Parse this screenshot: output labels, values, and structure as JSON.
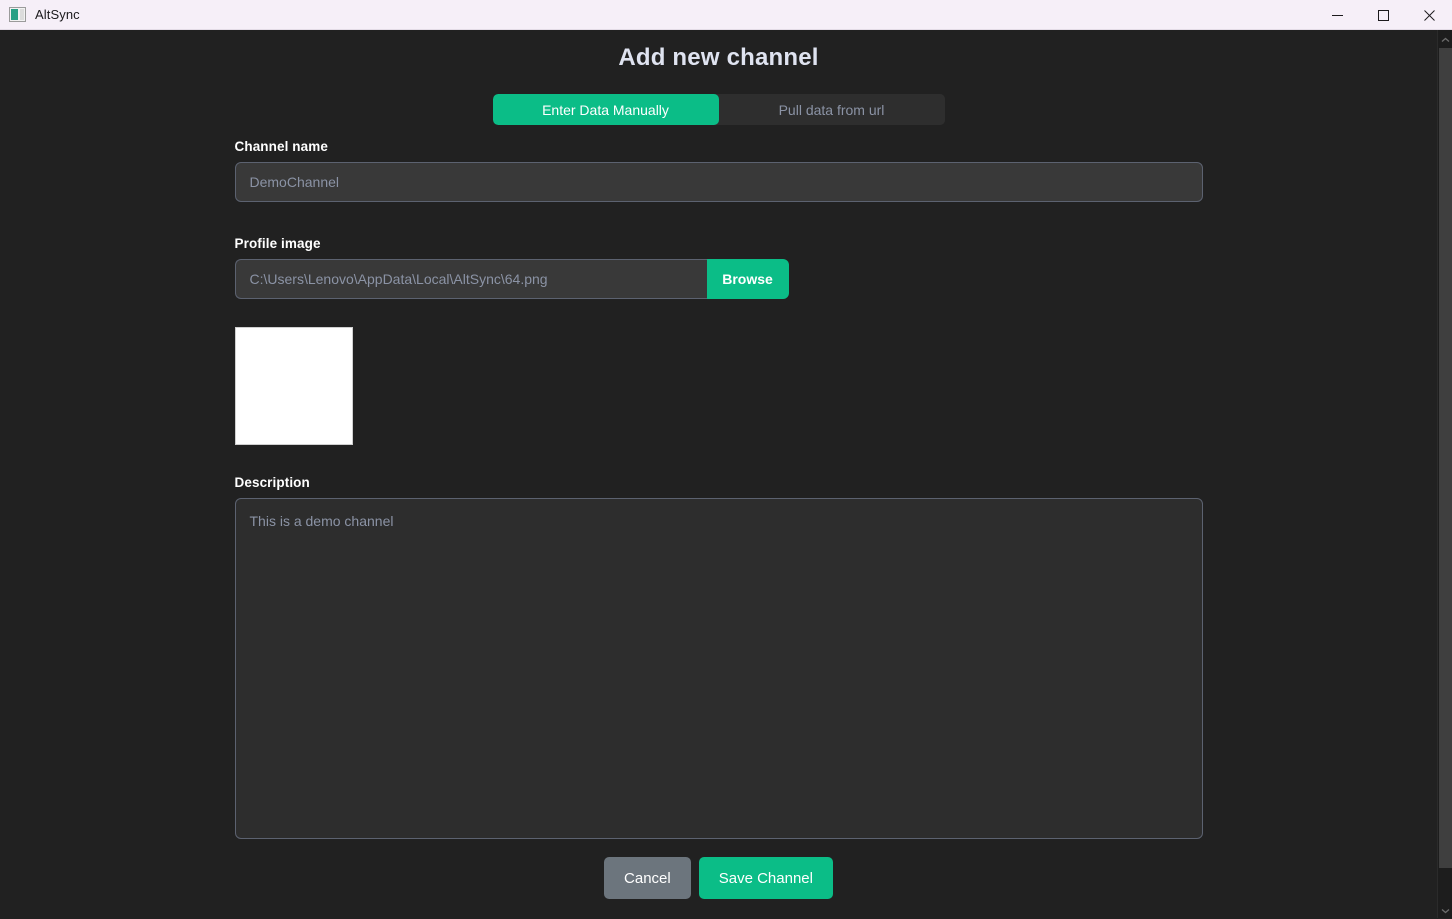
{
  "window": {
    "title": "AltSync",
    "icon": "app-icon",
    "controls": [
      {
        "name": "minimize",
        "glyph": "minimize-icon"
      },
      {
        "name": "maximize",
        "glyph": "maximize-icon"
      },
      {
        "name": "close",
        "glyph": "close-icon"
      }
    ]
  },
  "header": {
    "title": "Add new channel"
  },
  "tabs": [
    {
      "label": "Enter Data Manually",
      "active": true
    },
    {
      "label": "Pull data from url",
      "active": false
    }
  ],
  "form": {
    "channel_name": {
      "label": "Channel name",
      "value": "",
      "placeholder": "DemoChannel"
    },
    "profile_image": {
      "label": "Profile image",
      "value": "",
      "placeholder": "C:\\Users\\Lenovo\\AppData\\Local\\AltSync\\64.png",
      "browse_label": "Browse",
      "preview_alt": "profile-image-preview"
    },
    "description": {
      "label": "Description",
      "value": "",
      "placeholder": "This is a demo channel"
    }
  },
  "actions": {
    "cancel_label": "Cancel",
    "save_label": "Save Channel"
  },
  "scrollbar": {
    "up_arrow": "chevron-up-icon",
    "down_arrow": "chevron-down-icon"
  },
  "colors": {
    "accent_green": "#0bbd87",
    "page_background": "#212121",
    "input_background": "#393939",
    "textarea_background": "#2d2d2d",
    "titlebar_background": "#f6eff8",
    "cancel_gray": "#6c757d",
    "muted_text": "#8b93a5"
  }
}
